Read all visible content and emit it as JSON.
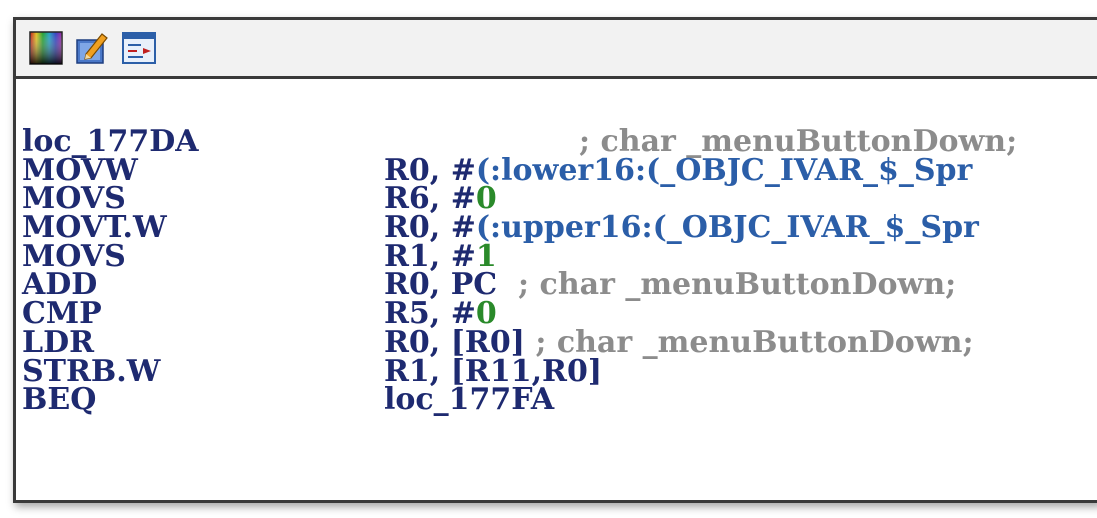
{
  "toolbar": {
    "buttons": [
      {
        "icon": "color-palette-icon"
      },
      {
        "icon": "edit-pencil-icon"
      },
      {
        "icon": "graph-view-icon"
      }
    ]
  },
  "colors": {
    "mnemonic": "#1e2a70",
    "symbol": "#2b5ea8",
    "immediate": "#2a8a2a",
    "comment": "#8c8c8c"
  },
  "listing": {
    "label_line": {
      "label": "loc_177DA",
      "comment": "; char _menuButtonDown;"
    },
    "rows": [
      {
        "mnemonic": "MOVW",
        "reg": "R0, ",
        "hash": "#",
        "imm": "",
        "symbol": "(:lower16:(_OBJC_IVAR_$_Spr",
        "rest": "",
        "comment": ""
      },
      {
        "mnemonic": "MOVS",
        "reg": "R6, ",
        "hash": "#",
        "imm": "0",
        "symbol": "",
        "rest": "",
        "comment": ""
      },
      {
        "mnemonic": "MOVT.W",
        "reg": "R0, ",
        "hash": "#",
        "imm": "",
        "symbol": "(:upper16:(_OBJC_IVAR_$_Spr",
        "rest": "",
        "comment": ""
      },
      {
        "mnemonic": "MOVS",
        "reg": "R1, ",
        "hash": "#",
        "imm": "1",
        "symbol": "",
        "rest": "",
        "comment": ""
      },
      {
        "mnemonic": "ADD",
        "reg": "R0, PC",
        "hash": "",
        "imm": "",
        "symbol": "",
        "rest": "",
        "comment": "  ; char _menuButtonDown;"
      },
      {
        "mnemonic": "CMP",
        "reg": "R5, ",
        "hash": "#",
        "imm": "0",
        "symbol": "",
        "rest": "",
        "comment": ""
      },
      {
        "mnemonic": "LDR",
        "reg": "R0, [R0]",
        "hash": "",
        "imm": "",
        "symbol": "",
        "rest": "",
        "comment": " ; char _menuButtonDown;"
      },
      {
        "mnemonic": "STRB.W",
        "reg": "R1, [R11,R0]",
        "hash": "",
        "imm": "",
        "symbol": "",
        "rest": "",
        "comment": ""
      },
      {
        "mnemonic": "BEQ",
        "reg": "loc_177FA",
        "hash": "",
        "imm": "",
        "symbol": "",
        "rest": "",
        "comment": ""
      }
    ]
  }
}
